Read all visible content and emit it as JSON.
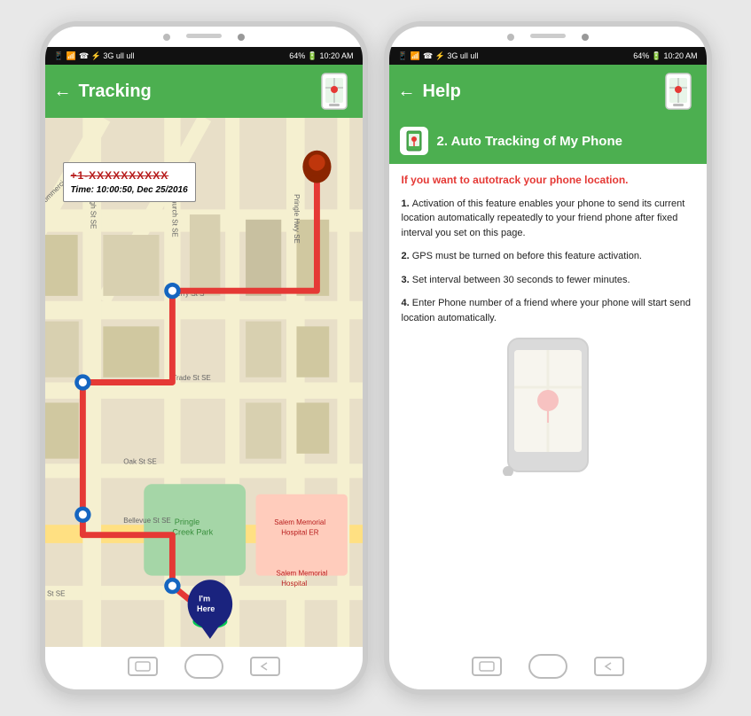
{
  "phone1": {
    "status_bar": {
      "left": "☎ ⚡ 3G ull ull",
      "right": "64% 🔋 10:20 AM"
    },
    "app_bar": {
      "back_icon": "←",
      "title": "Tracking"
    },
    "map_popup": {
      "phone": "+1-XXXXXXXXXX",
      "time": "Time: 10:00:50, Dec 25/2016"
    },
    "nav": {
      "left_label": "recent",
      "home_label": "home",
      "right_label": "back"
    }
  },
  "phone2": {
    "status_bar": {
      "left": "☎ ⚡ 3G ull ull",
      "right": "64% 🔋 10:20 AM"
    },
    "app_bar": {
      "back_icon": "←",
      "title": "Help"
    },
    "help": {
      "section_title": "2. Auto Tracking of My Phone",
      "subtitle": "If you want to autotrack your phone location.",
      "items": [
        "Activation of this feature enables your phone to send its current location automatically repeatedly to your friend phone after fixed interval you set on this page.",
        "GPS must be turned on before this feature activation.",
        "Set interval between 30 seconds to fewer minutes.",
        "Enter Phone number of a friend where your phone will start send location automatically."
      ]
    },
    "nav": {
      "left_label": "recent",
      "home_label": "home",
      "right_label": "back"
    }
  }
}
